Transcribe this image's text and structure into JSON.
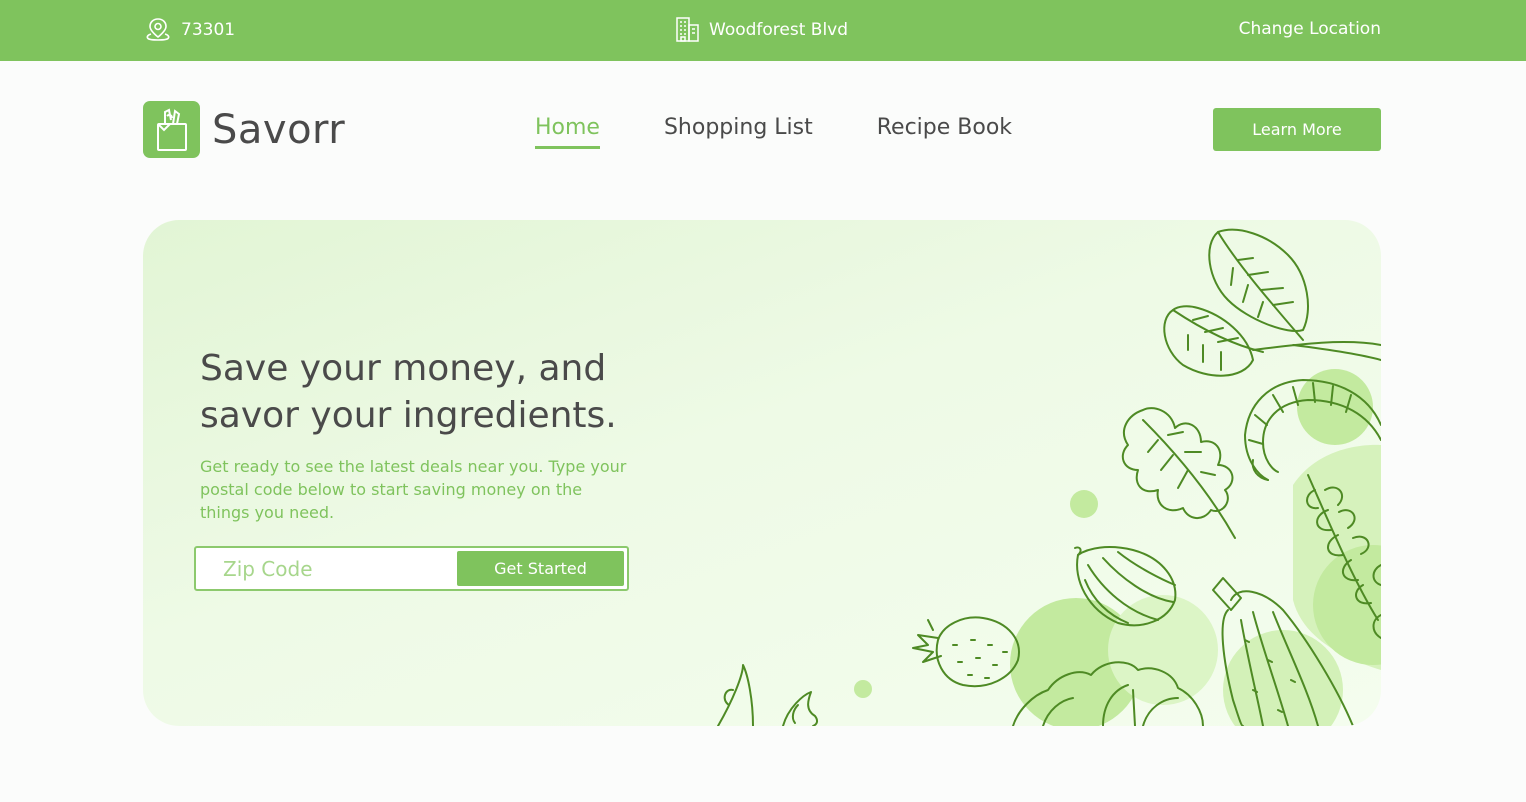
{
  "topbar": {
    "postal_code": "73301",
    "street": "Woodforest Blvd",
    "change_location": "Change Location",
    "location_icon": "location-pin-icon",
    "building_icon": "building-icon"
  },
  "header": {
    "brand": "Savorr",
    "logo_icon": "grocery-bag-icon",
    "nav": [
      {
        "label": "Home",
        "active": true
      },
      {
        "label": "Shopping List",
        "active": false
      },
      {
        "label": "Recipe Book",
        "active": false
      }
    ],
    "cta_label": "Learn More"
  },
  "hero": {
    "title_line1": "Save your money, and",
    "title_line2": "savor your ingredients.",
    "description": "Get ready to see the latest deals near you. Type your postal code below to start saving money on the things you need.",
    "zip_placeholder": "Zip Code",
    "zip_value": "",
    "submit_label": "Get Started",
    "illustration_icons": [
      "spinach-leaf-icon",
      "shrimp-icon",
      "oak-leaf-icon",
      "onion-icon",
      "strawberry-icon",
      "squash-icon",
      "rosemary-icon",
      "lettuce-icon"
    ]
  },
  "colors": {
    "accent": "#7fc35d",
    "hero_bg": "#e8f8df",
    "text": "#4a4a4a",
    "illustration_stroke": "#4e8a24",
    "blob": "#c3ea9f"
  }
}
